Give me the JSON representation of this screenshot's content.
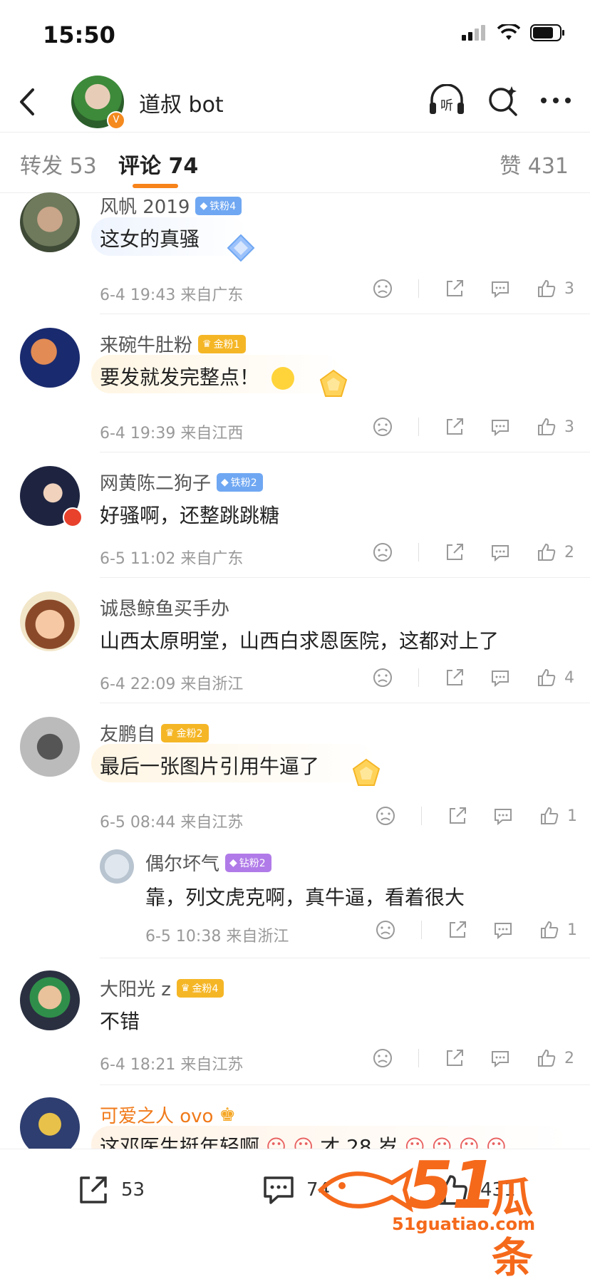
{
  "status": {
    "time": "15:50"
  },
  "nav": {
    "title": "道叔 bot"
  },
  "tabs": {
    "repost": "转发 53",
    "comment": "评论 74",
    "like": "赞 431"
  },
  "comments": [
    {
      "name": "风帆 2019",
      "badge": "铁粉4",
      "text": "这女的真骚",
      "meta": "6-4 19:43  来自广东",
      "likes": "3"
    },
    {
      "name": "来碗牛肚粉",
      "badge": "金粉1",
      "text": "要发就发完整点！",
      "meta": "6-4 19:39  来自江西",
      "likes": "3"
    },
    {
      "name": "网黄陈二狗子",
      "badge": "铁粉2",
      "text": "好骚啊，还整跳跳糖",
      "meta": "6-5 11:02  来自广东",
      "likes": "2"
    },
    {
      "name": "诚恳鲸鱼买手办",
      "text": "山西太原明堂，山西白求恩医院，这都对上了",
      "meta": "6-4 22:09  来自浙江",
      "likes": "4"
    },
    {
      "name": "友鹏自",
      "badge": "金粉2",
      "text": "最后一张图片引用牛逼了",
      "meta": "6-5 08:44  来自江苏",
      "likes": "1"
    },
    {
      "name": "偶尔坏气",
      "badge": "钻粉2",
      "text": "靠，列文虎克啊，真牛逼，看着很大",
      "meta": "6-5 10:38  来自浙江",
      "likes": "1"
    },
    {
      "name": "大阳光 z",
      "badge": "金粉4",
      "text": "不错",
      "meta": "6-4 18:21  来自江苏",
      "likes": "2"
    },
    {
      "name": "可爱之人 ovo",
      "text": "这邓医生挺年轻啊",
      "text2": "才 28 岁"
    }
  ],
  "bottom": {
    "repost": "53",
    "comment": "74",
    "like": "431"
  },
  "watermark": {
    "num": "51",
    "text": "瓜条",
    "url": "51guatiao.com"
  },
  "colors": {
    "accent": "#f7831a",
    "iron": "#6fa7f2",
    "gold": "#f5b626",
    "diamond": "#b07be8"
  }
}
